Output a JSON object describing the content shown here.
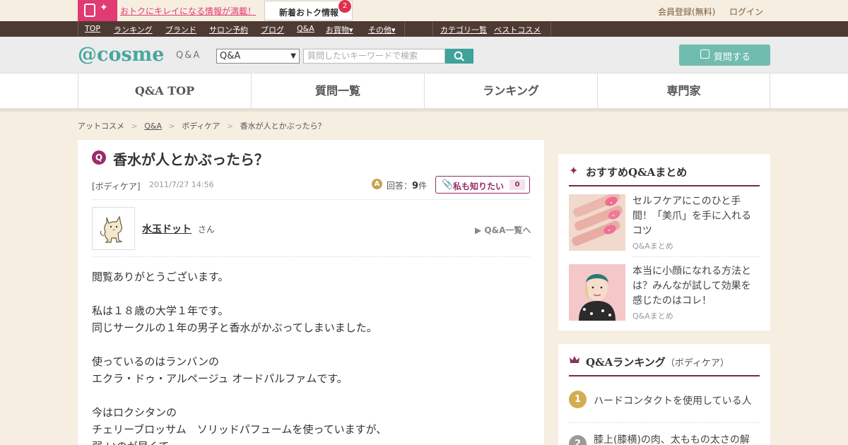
{
  "promo": {
    "text": "おトクにキレイになる情報が満載！",
    "news_label": "新着おトク情報",
    "news_count": "2"
  },
  "account": {
    "register": "会員登録(無料)",
    "login": "ログイン"
  },
  "nav": {
    "items": [
      "TOP",
      "ランキング",
      "ブランド",
      "サロン予約",
      "ブログ",
      "Q&A",
      "お買物▾",
      "その他▾"
    ],
    "right_items": [
      "カテゴリ一覧",
      "ベストコスメ"
    ]
  },
  "header": {
    "logo": "@cosme",
    "logo_sub": "Q&A",
    "select_value": "Q&A",
    "search_placeholder": "質問したいキーワードで検索",
    "ask_label": "質問する"
  },
  "tabs": [
    "Q&A TOP",
    "質問一覧",
    "ランキング",
    "専門家"
  ],
  "breadcrumb": [
    "アットコスメ",
    "Q&A",
    "ボディケア",
    "香水が人とかぶったら？"
  ],
  "question": {
    "title": "香水が人とかぶったら？",
    "category": "[ボディケア]",
    "date": "2011/7/27 14:56",
    "answers_label": "回答：",
    "answers_count": "9",
    "answers_unit": "件",
    "metoo_label": "私も知りたい",
    "metoo_count": "0",
    "user_name": "水玉ドット",
    "honorific": "さん",
    "qa_list_link": "▶ Q&A一覧へ",
    "body": [
      "閲覧ありがとうございます。",
      "",
      "私は１８歳の大学１年です。",
      "同じサークルの１年の男子と香水がかぶってしまいました。",
      "",
      "使っているのはランバンの",
      "エクラ・ドゥ・アルページュ オードパルファムです。",
      "",
      "今はロクシタンの",
      "チェリーブロッサム　ソリッドパフュームを使っていますが、",
      "弱 いのが早くて"
    ]
  },
  "recommend": {
    "title": "おすすめQ&Aまとめ",
    "items": [
      {
        "title": "セルフケアにこのひと手間！「美爪」を手に入れるコツ",
        "type": "Q&Aまとめ"
      },
      {
        "title": "本当に小顔になれる方法とは？みんなが試して効果を感じたのはコレ！",
        "type": "Q&Aまとめ"
      }
    ]
  },
  "ranking": {
    "title": "Q&Aランキング",
    "sub": "（ボディケア）",
    "items": [
      {
        "rank": "1",
        "title": "ハードコンタクトを使用している人"
      },
      {
        "rank": "2",
        "title": "膝上(膝横)の肉、太ももの太さの解"
      }
    ]
  },
  "colors": {
    "brand": "#49a6a0",
    "accent": "#9a2c6b",
    "promo": "#e03b72",
    "nav": "#4e3a33"
  }
}
